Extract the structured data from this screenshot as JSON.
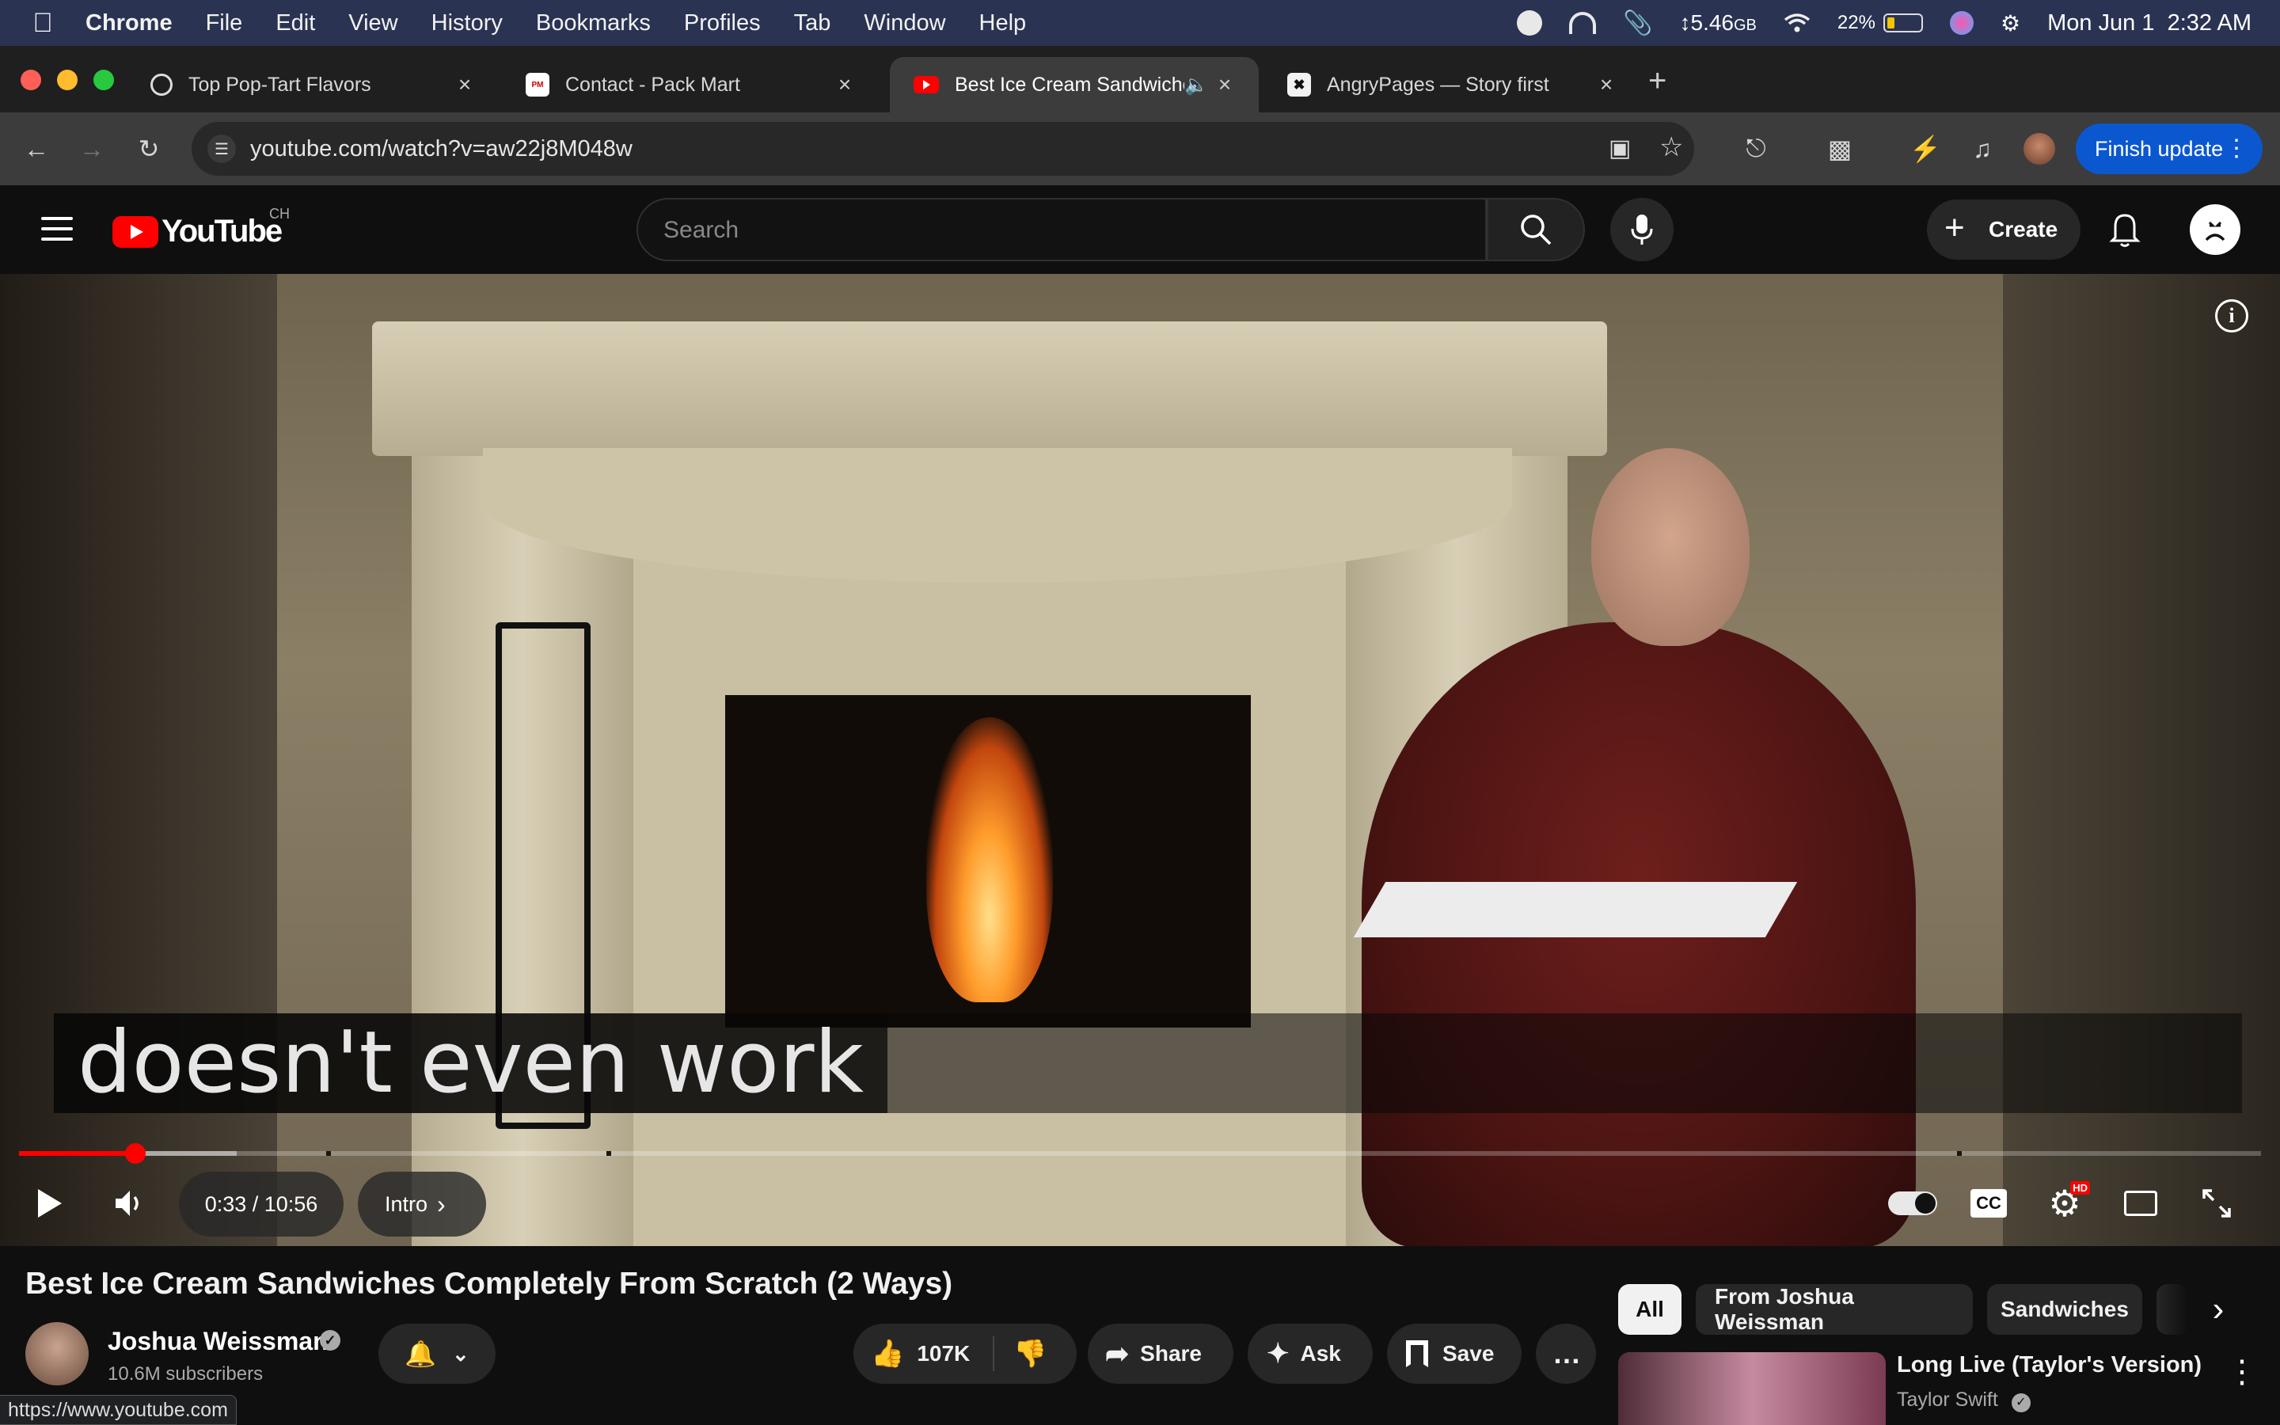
{
  "menubar": {
    "app": "Chrome",
    "items": [
      "File",
      "Edit",
      "View",
      "History",
      "Bookmarks",
      "Profiles",
      "Tab",
      "Window",
      "Help"
    ],
    "memory": "5.46",
    "memory_unit": "GB",
    "battery": "22%",
    "battery_fraction": 0.22,
    "datetime": "Mon Jun 1  2:32 AM"
  },
  "tabs": [
    {
      "title": "Top Pop-Tart Flavors",
      "icon": "openai-icon",
      "active": false
    },
    {
      "title": "Contact - Pack Mart",
      "icon": "packmart-icon",
      "active": false
    },
    {
      "title": "Best Ice Cream Sandwiche",
      "icon": "youtube-icon",
      "active": true,
      "audio": true
    },
    {
      "title": "AngryPages — Story first",
      "icon": "angrypages-icon",
      "active": false
    }
  ],
  "toolbar": {
    "url": "youtube.com/watch?v=aw22j8M048w",
    "update_label": "Finish update"
  },
  "youtube": {
    "logo_text": "YouTube",
    "region": "CH",
    "search_placeholder": "Search",
    "create_label": "Create"
  },
  "player": {
    "caption": "doesn't even work",
    "time": "0:33 / 10:56",
    "chapter": "Intro",
    "played_fraction": 0.052,
    "buffered_fraction": 0.097
  },
  "video": {
    "title": "Best Ice Cream Sandwiches Completely From Scratch (2 Ways)",
    "channel": "Joshua Weissman",
    "subscribers": "10.6M subscribers",
    "likes": "107K",
    "share_label": "Share",
    "ask_label": "Ask",
    "save_label": "Save"
  },
  "chips": [
    "All",
    "From Joshua Weissman",
    "Sandwiches"
  ],
  "recommendation": {
    "title": "Long Live (Taylor's Version)",
    "artist": "Taylor Swift"
  },
  "status_url": "https://www.youtube.com",
  "colors": {
    "menubar": "#2a3352",
    "youtube_red": "#ff0000",
    "update_blue": "#0b57d0",
    "background": "#0f0f0f"
  }
}
